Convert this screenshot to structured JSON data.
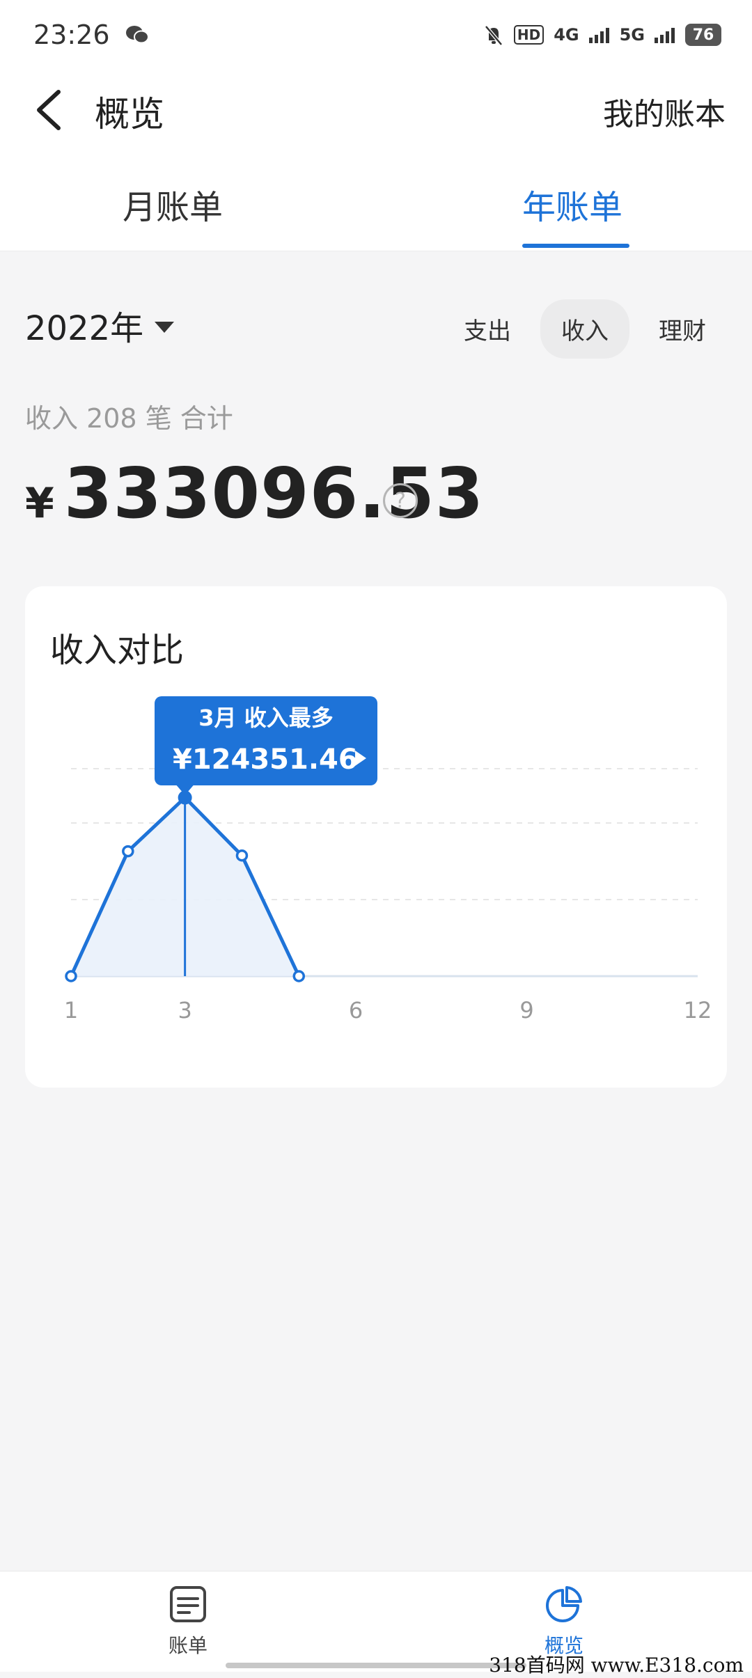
{
  "status_bar": {
    "time": "23:26",
    "network_4g": "4G",
    "network_5g": "5G",
    "hd_badge": "HD",
    "battery": "76"
  },
  "header": {
    "title": "概览",
    "right_link": "我的账本"
  },
  "tabs": [
    {
      "label": "月账单",
      "active": false
    },
    {
      "label": "年账单",
      "active": true
    }
  ],
  "filters": {
    "year": "2022年",
    "types": [
      "支出",
      "收入",
      "理财"
    ],
    "active_type": "收入"
  },
  "summary": {
    "caption": "收入 208 笔 合计",
    "currency": "¥",
    "total": "333096.53",
    "help_icon": "question-circle-icon"
  },
  "chart": {
    "title": "收入对比",
    "tooltip_title": "3月 收入最多",
    "tooltip_value": "¥124351.46"
  },
  "chart_data": {
    "type": "area",
    "title": "收入对比",
    "x": [
      1,
      2,
      3,
      4,
      5
    ],
    "values": [
      0,
      87000,
      124351.46,
      84000,
      0
    ],
    "x_ticks": [
      "1",
      "3",
      "6",
      "9",
      "12"
    ],
    "xlim": [
      1,
      12
    ],
    "ylim": [
      0,
      160000
    ],
    "grid": true,
    "highlight_index": 2,
    "color": "#1e73d8"
  },
  "bottom_nav": [
    {
      "label": "账单",
      "icon": "document-list-icon",
      "active": false
    },
    {
      "label": "概览",
      "icon": "pie-chart-icon",
      "active": true
    }
  ],
  "watermark": "318首码网 www.E318.com",
  "colors": {
    "accent": "#1e73d8",
    "background": "#f5f5f6"
  }
}
